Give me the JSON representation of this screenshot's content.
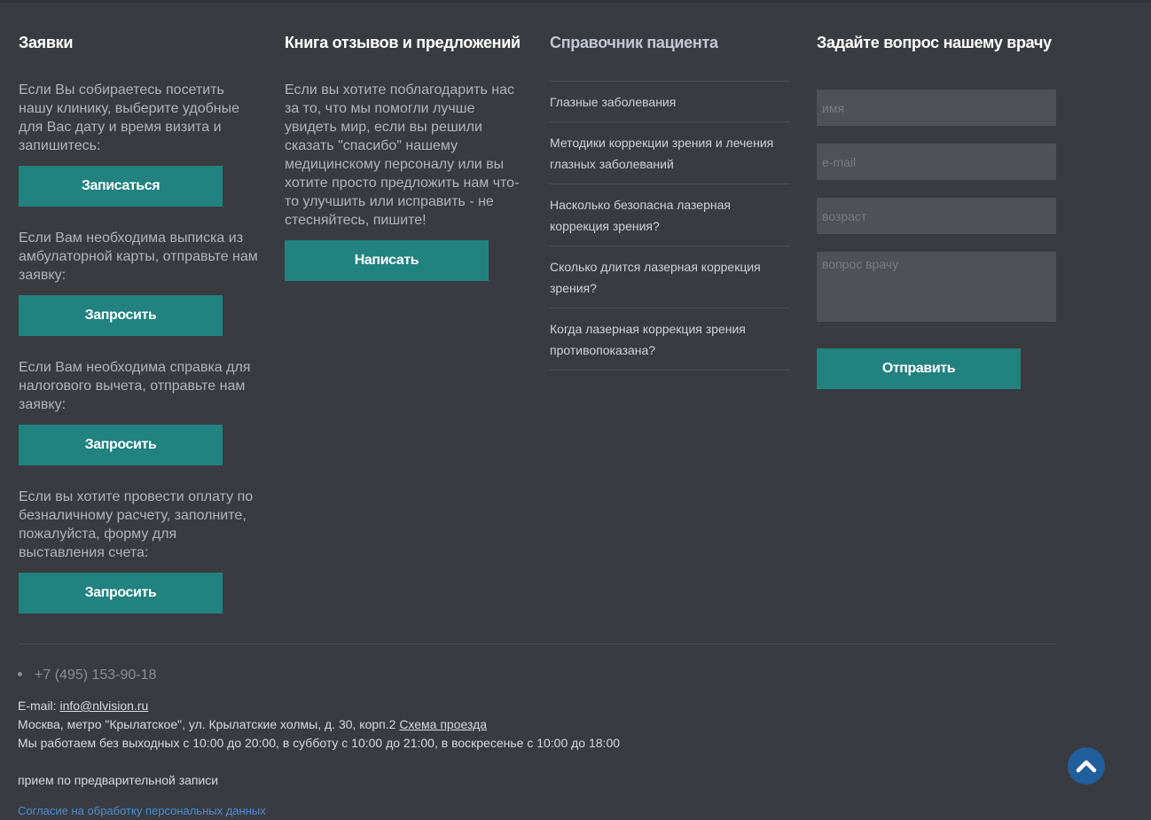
{
  "columns": {
    "requests": {
      "title": "Заявки",
      "blocks": [
        {
          "text": "Если Вы собираетесь посетить нашу клинику, выберите удобные для Вас дату и время визита и запишитесь:",
          "button": "Записаться"
        },
        {
          "text": "Если Вам необходима выписка из амбулаторной карты, отправьте нам заявку:",
          "button": "Запросить"
        },
        {
          "text": "Если Вам необходима справка для налогового вычета, отправьте нам заявку:",
          "button": "Запросить"
        },
        {
          "text": "Если вы хотите провести оплату по безналичному расчету, заполните, пожалуйста, форму для выставления счета:",
          "button": "Запросить"
        }
      ]
    },
    "reviews": {
      "title": "Книга отзывов и предложений",
      "text": "Если вы хотите поблагодарить нас за то, что мы помогли лучше увидеть мир, если вы решили сказать \"спасибо\" нашему медицинскому персоналу или вы хотите просто предложить нам что-то улучшить или исправить - не стесняйтесь, пишите!",
      "button": "Написать"
    },
    "handbook": {
      "title": "Справочник пациента",
      "items": [
        "Глазные заболевания",
        "Методики коррекции зрения и лечения глазных заболеваний",
        "Насколько безопасна лазерная коррекция зрения?",
        "Сколько длится лазерная коррекция зрения?",
        "Когда лазерная коррекция зрения противопоказана?"
      ]
    },
    "ask": {
      "title": "Задайте вопрос нашему врачу",
      "name_placeholder": "имя",
      "email_placeholder": "e-mail",
      "age_placeholder": "возраст",
      "question_placeholder": "вопрос врачу",
      "button": "Отправить"
    }
  },
  "footer": {
    "phone": "+7 (495) 153-90-18",
    "email_label": "E-mail:",
    "email": "info@nlvision.ru",
    "address": "Москва, метро \"Крылатское\", ул. Крылатские холмы, д. 30, корп.2",
    "route_link": "Схема проезда",
    "hours": "Мы работаем без выходных с 10:00 до 20:00, в субботу с 10:00 до 21:00, в воскресенье с 10:00 до 18:00",
    "appointment": "прием по предварительной записи",
    "consent": "Согласие на обработку персональных данных"
  },
  "colors": {
    "background": "#3a3b41",
    "button": "#21827f",
    "link": "#4a90d9",
    "scroll_top": "#215e9c"
  },
  "icons": {
    "scroll_top": "chevron-up-icon",
    "bullet": "bullet-dot-icon"
  }
}
